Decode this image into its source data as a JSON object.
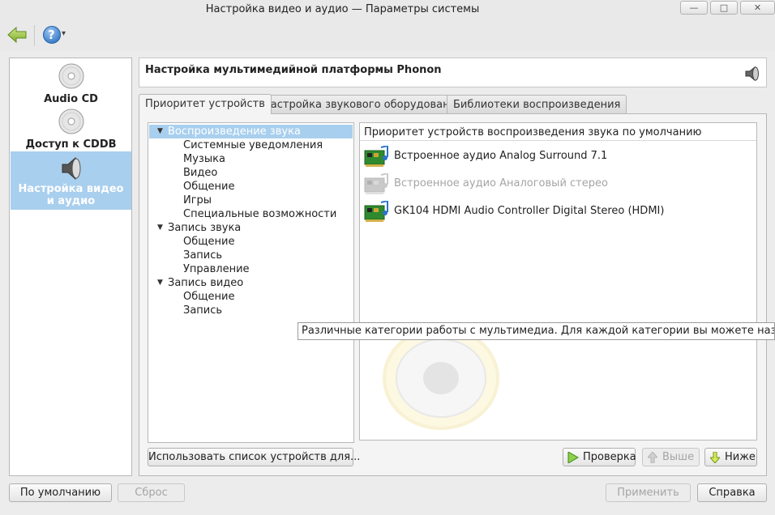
{
  "window": {
    "title": "Настройка видео и аудио — Параметры системы",
    "controls": [
      "minimize-icon",
      "maximize-icon",
      "close-icon"
    ]
  },
  "toolbar": {
    "back_icon": "back-arrow-icon",
    "help_icon": "help-icon",
    "help_glyph": "?",
    "dropdown_glyph": "▾"
  },
  "sidebar": {
    "items": [
      {
        "label": "Audio CD",
        "icon": "cd-icon"
      },
      {
        "label": "Доступ к CDDB",
        "icon": "cd-icon"
      },
      {
        "label": "Настройка видео и аудио",
        "label_line1": "Настройка видео",
        "label_line2": "и аудио",
        "icon": "speaker-icon",
        "selected": true
      }
    ]
  },
  "header": {
    "title": "Настройка мультимедийной платформы Phonon",
    "icon": "speaker-icon"
  },
  "tabs": [
    {
      "label": "Приоритет устройств",
      "active": true
    },
    {
      "label": "Настройка звукового оборудования",
      "active": false
    },
    {
      "label": "Библиотеки воспроизведения",
      "active": false
    }
  ],
  "tree": {
    "rows": [
      {
        "label": "Воспроизведение звука",
        "level": 0,
        "expanded": true,
        "selected": true
      },
      {
        "label": "Системные уведомления",
        "level": 1
      },
      {
        "label": "Музыка",
        "level": 1
      },
      {
        "label": "Видео",
        "level": 1
      },
      {
        "label": "Общение",
        "level": 1
      },
      {
        "label": "Игры",
        "level": 1
      },
      {
        "label": "Специальные возможности",
        "level": 1
      },
      {
        "label": "Запись звука",
        "level": 0,
        "expanded": true
      },
      {
        "label": "Общение",
        "level": 1
      },
      {
        "label": "Запись",
        "level": 1
      },
      {
        "label": "Управление",
        "level": 1
      },
      {
        "label": "Запись видео",
        "level": 0,
        "expanded": true
      },
      {
        "label": "Общение",
        "level": 1
      },
      {
        "label": "Запись",
        "level": 1
      }
    ]
  },
  "devices": {
    "header": "Приоритет устройств воспроизведения звука по умолчанию",
    "items": [
      {
        "label": "Встроенное аудио Analog Surround 7.1",
        "icon": "sound-card-icon",
        "enabled": true
      },
      {
        "label": "Встроенное аудио Аналоговый стерео",
        "icon": "sound-card-icon",
        "enabled": false
      },
      {
        "label": "GK104 HDMI Audio Controller Digital Stereo (HDMI)",
        "icon": "sound-card-icon",
        "enabled": true
      }
    ]
  },
  "tooltip": {
    "text": "Различные категории работы с мультимедиа. Для каждой категории вы можете назначить отде"
  },
  "panel_buttons": {
    "use_list": "Использовать список устройств для...",
    "test": "Проверка",
    "up": "Выше",
    "down": "Ниже"
  },
  "footer": {
    "defaults": "По умолчанию",
    "reset": "Сброс",
    "apply": "Применить",
    "help": "Справка"
  },
  "colors": {
    "selection": "#a9cfee",
    "disabled_text": "#a5a5a5",
    "accent_green": "#3aa43a"
  }
}
